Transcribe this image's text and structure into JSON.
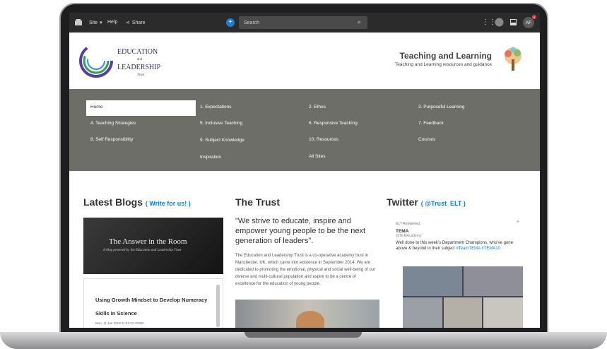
{
  "topbar": {
    "site_label": "Site",
    "help_label": "Help",
    "share_label": "Share",
    "search_placeholder": "Search",
    "avatar_initials": "AF",
    "notification_count": "5"
  },
  "header": {
    "brand_line1": "EDUCATION",
    "brand_line2": "and",
    "brand_line3": "LEADERSHIP",
    "brand_line4": "Trust",
    "title": "Teaching and Learning",
    "subtitle": "Teaching and Learning resources and guidance"
  },
  "nav": {
    "items": [
      "Home",
      "1. Expectations",
      "2. Ethos",
      "3. Purposeful Learning",
      "4. Teaching Strategies",
      "5. Inclusive Teaching",
      "6. Responsive Teaching",
      "7. Feedback",
      "8. Self Responsibility",
      "9. Subject Knowledge Inspiration",
      "10. Resources",
      "Courses",
      "All Sites"
    ]
  },
  "blogs": {
    "heading": "Latest Blogs",
    "link": "Write for us!",
    "image_title": "The Answer in the Room",
    "image_subtitle": "A blog powered by the Education and Leadership Trust",
    "post_title": "Using Growth Mindset to Develop Numeracy Skills in Science",
    "post_date": "Mon, 11 Jun 2018 11:24:22 +0000"
  },
  "trust": {
    "heading": "The Trust",
    "quote": "\"We strive to educate, inspire and empower young people to be the next generation of leaders\".",
    "paragraph": "The Education and Leadership Trust is a co-operative academy trust in Manchester, UK, which came into existence in September 2014. We are dedicated to promoting the emotional, physical and social well-being of our diverse and multi-cultural population and aspire to be a centre of excellence for the education of young people."
  },
  "twitter": {
    "heading": "Twitter",
    "handle_link": "@Trust_ELT",
    "retweet_label": "ELT Retweeted",
    "account_name": "TEMA",
    "account_handle": "@TEMAcademy",
    "tweet_text": "Well done to this week's Department Champions, who've gone above & beyond in their subject",
    "hashtags": "#TeamTEMA #TEMA10"
  },
  "colors": {
    "topbar": "#2b2b2b",
    "nav_bg": "#6e6e69",
    "link": "#1a7fd4",
    "brand": "#3c2a72"
  }
}
